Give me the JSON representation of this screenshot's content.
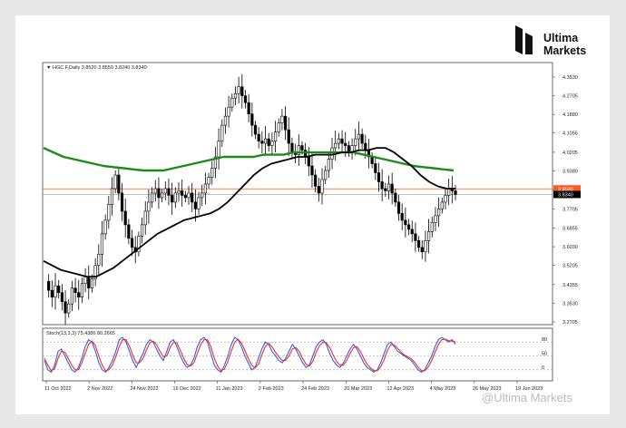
{
  "brand": {
    "line1": "Ultima",
    "line2": "Markets"
  },
  "watermark": "@Ultima Markets",
  "chart_data": [
    {
      "type": "candlestick",
      "header": "HGC.F,Daily  3.8520 3.8550 3.8240 3.8340",
      "ylim": [
        3.2705,
        4.353
      ],
      "y_ticks": [
        "4.3530",
        "4.2705",
        "4.1880",
        "4.1055",
        "4.0205",
        "3.9380",
        "3.8555",
        "3.7705",
        "3.6855",
        "3.6030",
        "3.5205",
        "3.4355",
        "3.3530",
        "3.2705"
      ],
      "x_ticks": [
        "11 Oct 2022",
        "2 Nov 2022",
        "24 Nov 2022",
        "16 Dec 2022",
        "11 Jan 2023",
        "2 Feb 2023",
        "24 Feb 2023",
        "20 Mar 2023",
        "12 Apr 2023",
        "4 May 2023",
        "26 May 2023",
        "19 Jun 2023"
      ],
      "price_labels": [
        {
          "text": "3.8590",
          "value": 3.859,
          "color": "#ff5a1f"
        },
        {
          "text": "3.8340",
          "value": 3.834,
          "color": "#000000"
        }
      ],
      "close_series": [
        3.45,
        3.41,
        3.38,
        3.43,
        3.4,
        3.36,
        3.31,
        3.35,
        3.42,
        3.4,
        3.38,
        3.44,
        3.47,
        3.42,
        3.46,
        3.52,
        3.57,
        3.66,
        3.72,
        3.79,
        3.86,
        3.92,
        3.84,
        3.76,
        3.7,
        3.64,
        3.6,
        3.58,
        3.65,
        3.7,
        3.76,
        3.8,
        3.84,
        3.86,
        3.82,
        3.84,
        3.86,
        3.83,
        3.8,
        3.84,
        3.85,
        3.83,
        3.82,
        3.84,
        3.8,
        3.77,
        3.82,
        3.84,
        3.88,
        3.91,
        3.95,
        4.0,
        4.07,
        4.14,
        4.18,
        4.22,
        4.26,
        4.28,
        4.31,
        4.27,
        4.24,
        4.19,
        4.14,
        4.1,
        4.07,
        4.06,
        4.08,
        4.05,
        4.07,
        4.11,
        4.15,
        4.18,
        4.12,
        4.06,
        4.02,
        4.01,
        4.05,
        4.03,
        4.0,
        3.96,
        3.92,
        3.87,
        3.84,
        3.9,
        3.94,
        3.99,
        4.04,
        4.06,
        4.08,
        4.06,
        4.05,
        4.02,
        4.05,
        4.08,
        4.1,
        4.06,
        4.03,
        4.0,
        3.97,
        3.93,
        3.89,
        3.86,
        3.85,
        3.88,
        3.84,
        3.8,
        3.75,
        3.72,
        3.7,
        3.68,
        3.66,
        3.63,
        3.6,
        3.58,
        3.63,
        3.67,
        3.71,
        3.74,
        3.77,
        3.8,
        3.83,
        3.86,
        3.85,
        3.834
      ],
      "sma_fast": [
        3.54,
        3.52,
        3.5,
        3.49,
        3.48,
        3.47,
        3.47,
        3.49,
        3.51,
        3.54,
        3.57,
        3.6,
        3.63,
        3.66,
        3.68,
        3.7,
        3.72,
        3.73,
        3.74,
        3.75,
        3.77,
        3.8,
        3.84,
        3.88,
        3.92,
        3.95,
        3.97,
        3.98,
        3.99,
        4.0,
        4.0,
        4.01,
        4.01,
        4.01,
        4.02,
        4.02,
        4.03,
        4.03,
        4.04,
        4.04,
        4.02,
        3.99,
        3.96,
        3.92,
        3.89,
        3.87,
        3.86,
        3.86
      ],
      "sma_slow": [
        4.04,
        4.02,
        4.0,
        3.99,
        3.98,
        3.97,
        3.96,
        3.955,
        3.95,
        3.945,
        3.94,
        3.94,
        3.94,
        3.95,
        3.96,
        3.97,
        3.98,
        3.99,
        4.0,
        4.0,
        4.0,
        4.0,
        4.01,
        4.01,
        4.01,
        4.02,
        4.02,
        4.02,
        4.02,
        4.02,
        4.02,
        4.02,
        4.01,
        4.0,
        3.99,
        3.98,
        3.97,
        3.96,
        3.955,
        3.95,
        3.945,
        3.94
      ],
      "sma_colors": {
        "fast": "#000000",
        "slow": "#1a8c1a"
      }
    },
    {
      "type": "line",
      "title": "Stoch(13,3,3) 75.4386 80.2665",
      "ylim": [
        0,
        100
      ],
      "levels": [
        80,
        50,
        20
      ],
      "level_labels": [
        "80",
        "50",
        "0"
      ],
      "series": [
        {
          "color": "#3b5bdb",
          "values": [
            40,
            20,
            15,
            30,
            60,
            65,
            50,
            35,
            20,
            15,
            25,
            45,
            70,
            85,
            80,
            60,
            35,
            20,
            15,
            25,
            40,
            60,
            85,
            90,
            80,
            60,
            40,
            25,
            40,
            55,
            75,
            85,
            80,
            65,
            50,
            40,
            60,
            80,
            85,
            70,
            50,
            35,
            25,
            30,
            45,
            70,
            85,
            90,
            80,
            55,
            30,
            20,
            15,
            30,
            50,
            75,
            90,
            85,
            70,
            50,
            35,
            20,
            25,
            45,
            65,
            80,
            75,
            60,
            50,
            40,
            35,
            45,
            60,
            75,
            65,
            50,
            35,
            25,
            30,
            50,
            70,
            80,
            85,
            75,
            55,
            40,
            30,
            25,
            35,
            50,
            65,
            75,
            65,
            50,
            35,
            25,
            20,
            15,
            20,
            35,
            55,
            75,
            80,
            70,
            60,
            55,
            50,
            45,
            40,
            30,
            20,
            15,
            20,
            35,
            50,
            70,
            85,
            90,
            85,
            80,
            85,
            75
          ]
        },
        {
          "color": "#e03131",
          "values": [
            45,
            30,
            18,
            22,
            45,
            60,
            58,
            45,
            30,
            20,
            20,
            35,
            55,
            75,
            82,
            72,
            50,
            30,
            18,
            20,
            30,
            48,
            70,
            85,
            85,
            72,
            52,
            35,
            35,
            45,
            62,
            78,
            82,
            75,
            60,
            48,
            50,
            68,
            80,
            78,
            62,
            45,
            32,
            28,
            35,
            55,
            75,
            85,
            85,
            70,
            45,
            28,
            18,
            22,
            38,
            60,
            80,
            86,
            78,
            62,
            45,
            30,
            24,
            32,
            52,
            70,
            77,
            70,
            58,
            48,
            40,
            40,
            50,
            65,
            68,
            60,
            45,
            32,
            28,
            38,
            58,
            72,
            80,
            78,
            68,
            52,
            38,
            30,
            30,
            40,
            55,
            68,
            70,
            60,
            45,
            32,
            24,
            18,
            18,
            26,
            42,
            62,
            75,
            74,
            66,
            58,
            52,
            48,
            44,
            36,
            26,
            18,
            18,
            26,
            40,
            58,
            75,
            85,
            86,
            83,
            82,
            80
          ]
        }
      ]
    }
  ]
}
